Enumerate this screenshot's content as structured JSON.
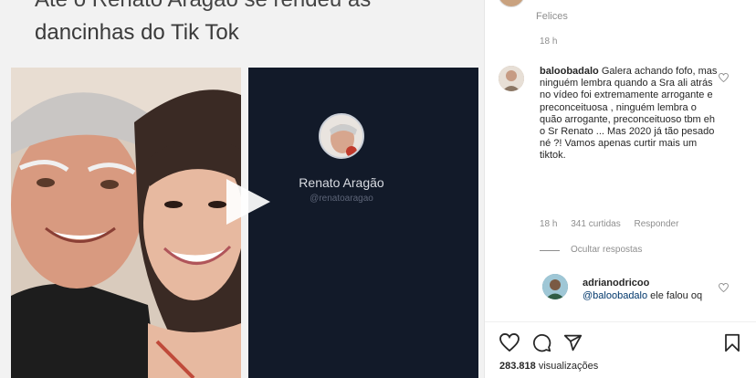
{
  "post": {
    "headline_top": "Até o Renato Aragão se rendeu às",
    "headline": "dancinhas do Tik Tok",
    "video": {
      "name": "Renato Aragão",
      "handle": "@renatoaragao"
    }
  },
  "comments_panel": {
    "top_partial_text": "Felices",
    "top_time": "18 h",
    "comment": {
      "username": "baloobadalo",
      "text": "Galera achando fofo, mas ninguém lembra quando a Sra ali atrás no vídeo foi extremamente arrogante e preconceituosa , ninguém lembra o quão arrogante, preconceituoso tbm eh o Sr Renato ... Mas 2020 já tão pesado né ?! Vamos apenas curtir mais um tiktok.",
      "time": "18 h",
      "likes": "341 curtidas",
      "reply_label": "Responder",
      "hide_replies": "Ocultar respostas"
    },
    "reply": {
      "username": "adrianodricoo",
      "mention": "@baloobadalo",
      "text": " ele falou oq"
    },
    "actions": {
      "views_count": "283.818",
      "views_label": "visualizações"
    }
  },
  "colors": {
    "video_bg": "#121a29",
    "muted_text": "#8e8e8e",
    "mention": "#00376b"
  }
}
